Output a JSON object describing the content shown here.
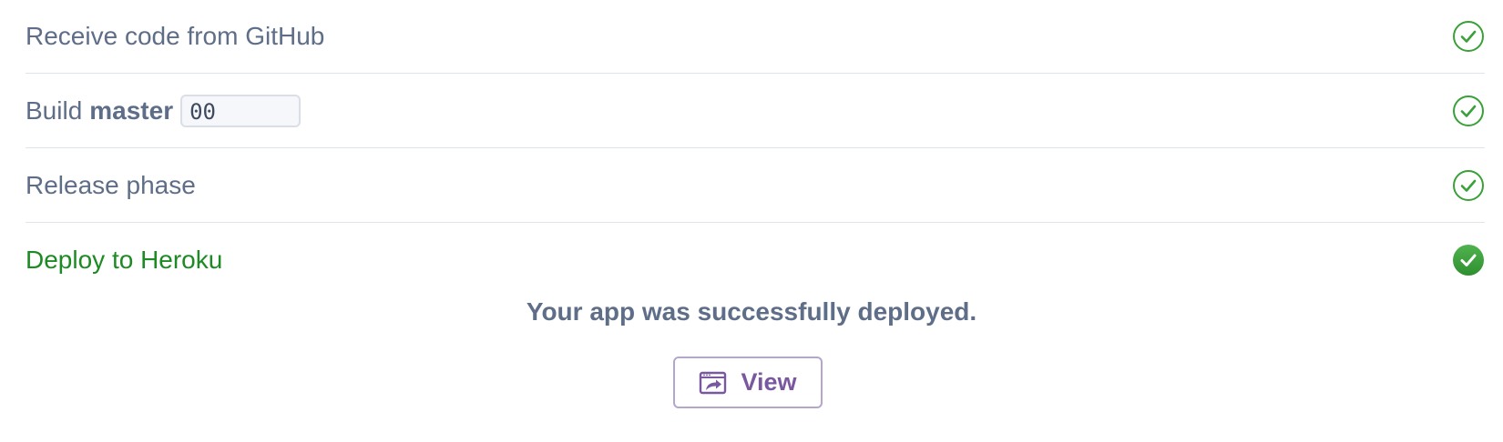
{
  "steps": [
    {
      "label": "Receive code from GitHub",
      "status": "done",
      "icon": "check-circle-outline-icon"
    },
    {
      "label": "Build",
      "branch": "master",
      "commit": "00",
      "status": "done",
      "icon": "check-circle-outline-icon"
    },
    {
      "label": "Release phase",
      "status": "done",
      "icon": "check-circle-outline-icon"
    },
    {
      "label": "Deploy to Heroku",
      "status": "success",
      "icon": "check-circle-filled-icon"
    }
  ],
  "result": {
    "message": "Your app was successfully deployed.",
    "view_button": {
      "label": "View",
      "icon": "external-window-icon"
    }
  },
  "colors": {
    "text": "#5f6e88",
    "success": "#1d8a24",
    "check_outline": "#3aa03a",
    "button": "#79589f",
    "button_border": "#b5a6cc",
    "divider": "#dfe3ea"
  }
}
